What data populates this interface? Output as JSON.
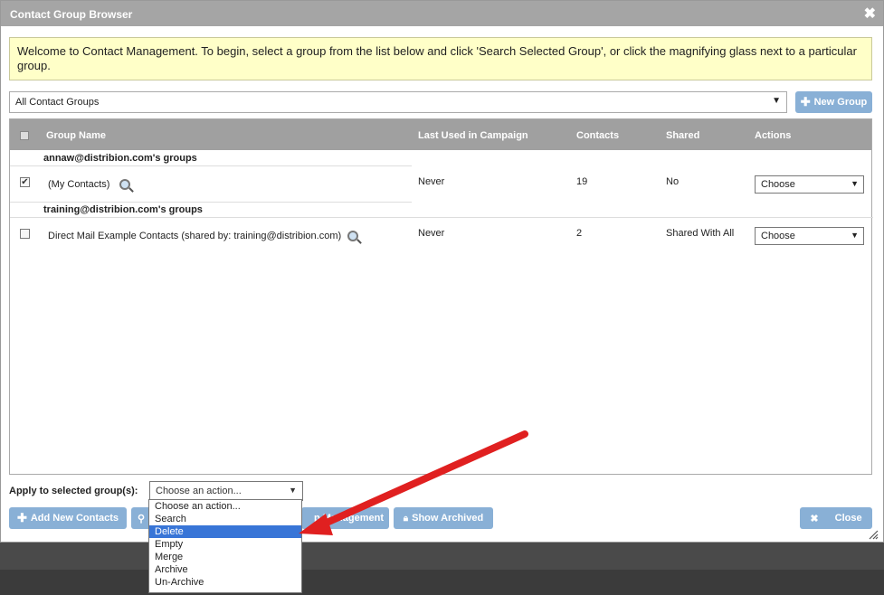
{
  "dialog": {
    "title": "Contact Group Browser",
    "close_glyph": "✖"
  },
  "welcome_text": "Welcome to Contact Management. To begin, select a group from the list below and click 'Search Selected Group', or click the magnifying glass next to a particular group.",
  "group_filter": {
    "value": "All Contact Groups"
  },
  "new_group_label": "New Group",
  "columns": [
    "Group Name",
    "Last Used in Campaign",
    "Contacts",
    "Shared",
    "Actions"
  ],
  "owners": [
    "annaw@distribion.com's groups",
    "training@distribion.com's groups"
  ],
  "rows": [
    {
      "name": "(My Contacts)",
      "checked": true,
      "last_used": "Never",
      "contacts": "19",
      "shared": "No",
      "action": "Choose"
    },
    {
      "name": "Direct Mail Example Contacts (shared by: training@distribion.com)",
      "checked": false,
      "last_used": "Never",
      "contacts": "2",
      "shared": "Shared With All",
      "action": "Choose"
    }
  ],
  "apply_label": "Apply to selected group(s):",
  "apply_select": {
    "value": "Choose an action...",
    "options": [
      "Choose an action...",
      "Search",
      "Delete",
      "Empty",
      "Merge",
      "Archive",
      "Un-Archive"
    ],
    "highlighted": "Delete"
  },
  "buttons": {
    "add_contacts": "Add New Contacts",
    "management_partial": "p Management",
    "show_archived": "Show Archived",
    "close": "Close"
  },
  "colors": {
    "title_bar": "#a5a5a5",
    "button_blue": "#89b0d6",
    "welcome_bg": "#ffffc8",
    "highlight": "#3875d7",
    "annotation_arrow": "#e02020"
  }
}
